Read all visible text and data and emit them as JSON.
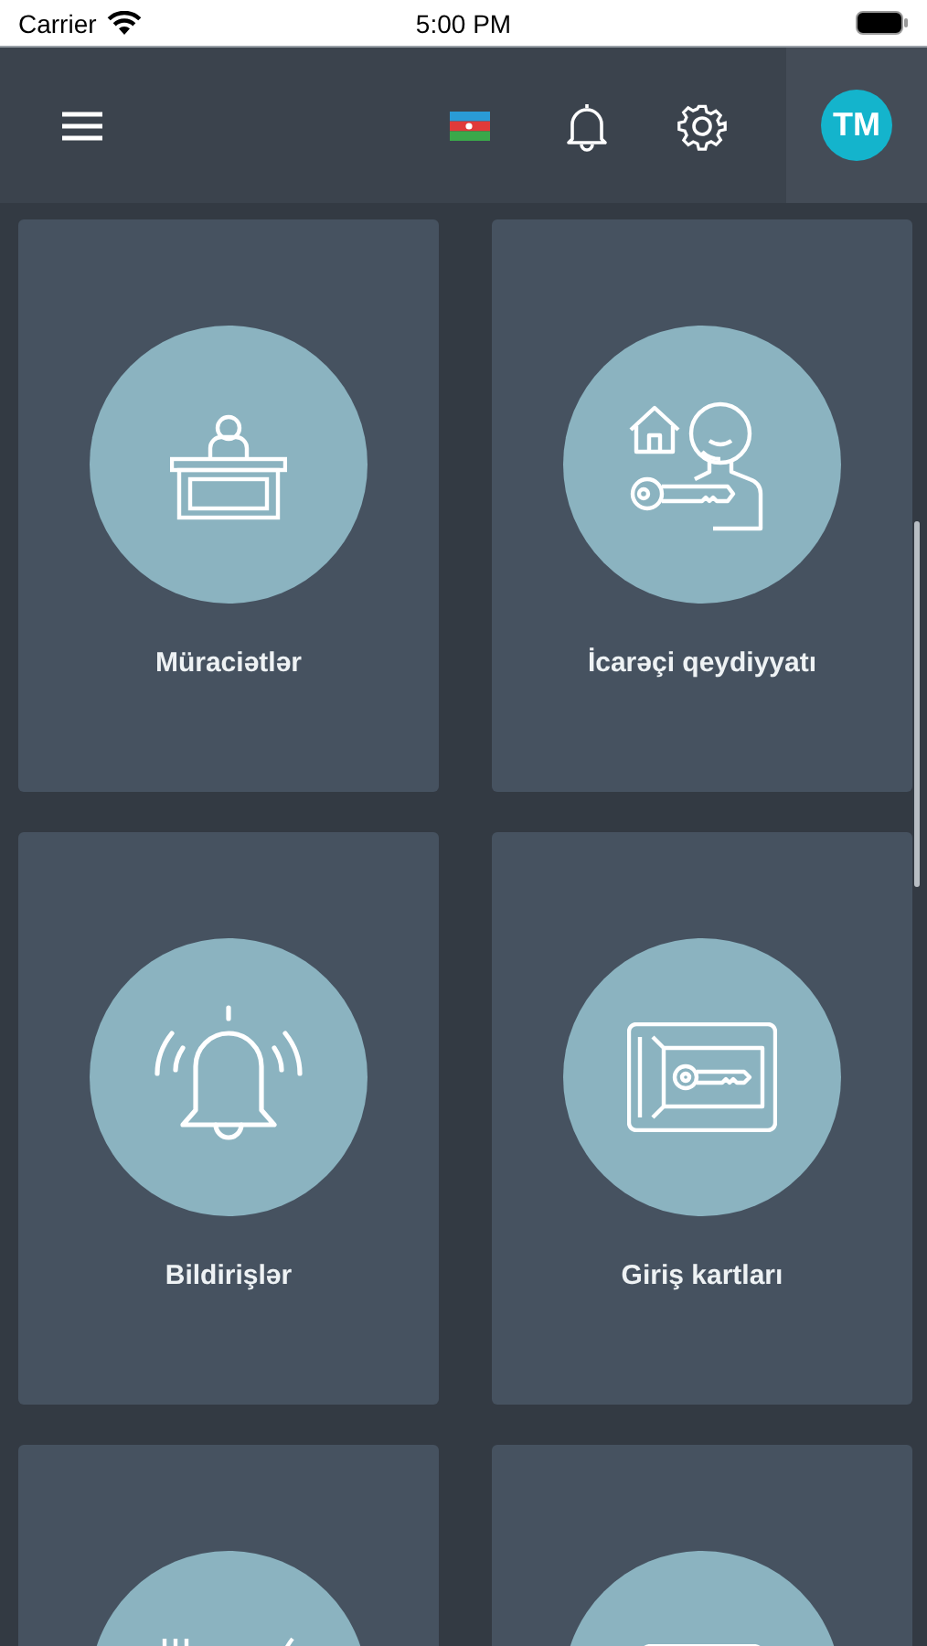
{
  "status_bar": {
    "carrier": "Carrier",
    "time": "5:00 PM"
  },
  "header": {
    "avatar_initials": "TM"
  },
  "tiles": [
    {
      "kind": "desk",
      "label": "Müraciətlər"
    },
    {
      "kind": "tenant",
      "label": "İcarəçi qeydiyyatı"
    },
    {
      "kind": "bell",
      "label": "Bildirişlər"
    },
    {
      "kind": "card",
      "label": "Giriş kartları"
    },
    {
      "kind": "food"
    },
    {
      "kind": "panel"
    }
  ]
}
